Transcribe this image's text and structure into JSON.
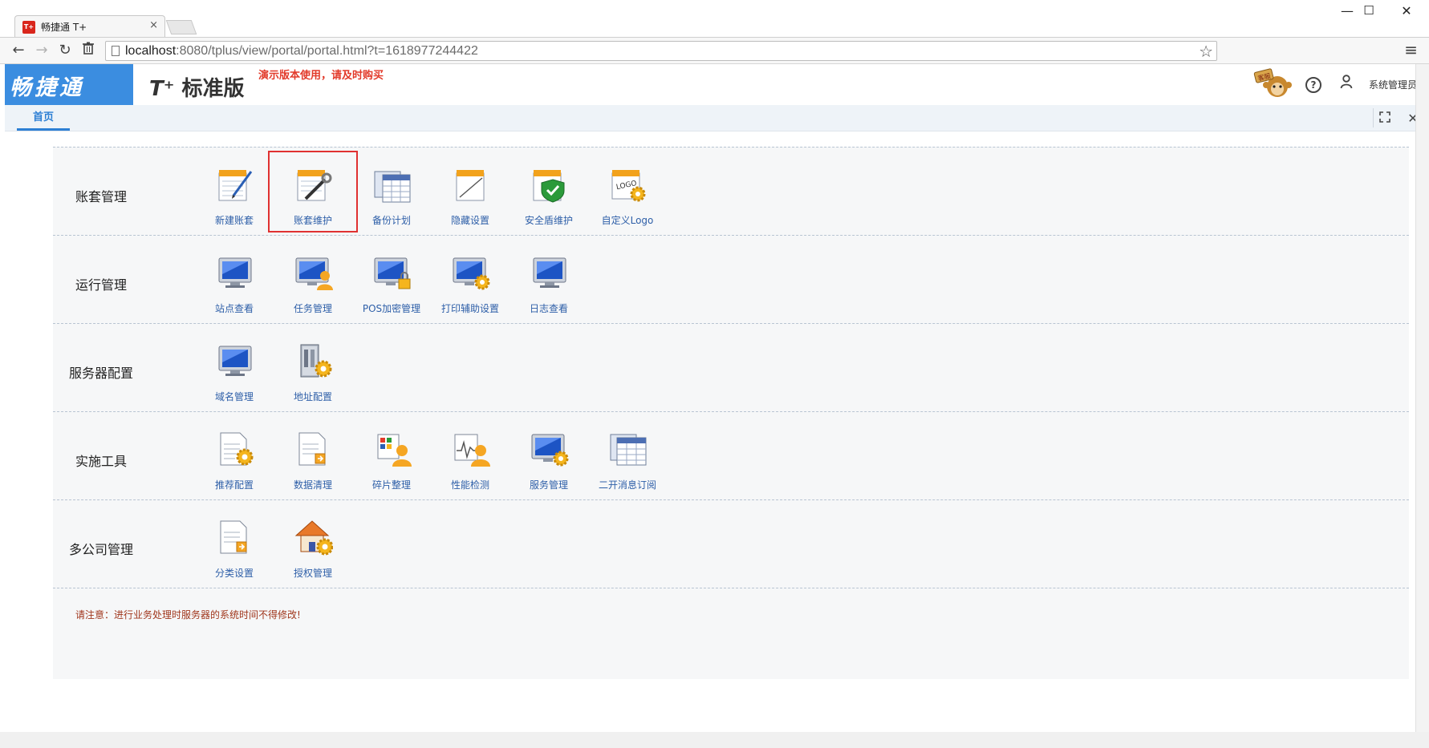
{
  "browser": {
    "tab_title": "畅捷通 T+",
    "tab_favicon": "T+",
    "tab_close": "×",
    "url_host": "localhost",
    "url_rest": ":8080/tplus/view/portal/portal.html?t=1618977244422",
    "window_controls": {
      "minimize": "—",
      "maximize": "☐",
      "close": "✕"
    }
  },
  "header": {
    "brand": "畅捷通",
    "product_prefix": "T⁺",
    "product_name": "标准版",
    "demo_note": "演示版本使用，请及时购买",
    "user": "系统管理员",
    "kefu_label": "客服"
  },
  "page_tabs": [
    {
      "label": "首页",
      "active": true
    }
  ],
  "sections": [
    {
      "label": "账套管理",
      "items": [
        {
          "label": "新建账套",
          "icon": "ledger-pen-icon"
        },
        {
          "label": "账套维护",
          "icon": "ledger-wrench-icon",
          "selected": true
        },
        {
          "label": "备份计划",
          "icon": "backup-calendar-icon"
        },
        {
          "label": "隐藏设置",
          "icon": "hidden-setting-icon"
        },
        {
          "label": "安全盾维护",
          "icon": "shield-check-icon"
        },
        {
          "label": "自定义Logo",
          "icon": "logo-gear-icon"
        }
      ]
    },
    {
      "label": "运行管理",
      "items": [
        {
          "label": "站点查看",
          "icon": "monitor-icon"
        },
        {
          "label": "任务管理",
          "icon": "monitor-user-icon"
        },
        {
          "label": "POS加密管理",
          "icon": "monitor-lock-icon"
        },
        {
          "label": "打印辅助设置",
          "icon": "monitor-gear-icon"
        },
        {
          "label": "日志查看",
          "icon": "monitor-log-icon"
        }
      ]
    },
    {
      "label": "服务器配置",
      "items": [
        {
          "label": "域名管理",
          "icon": "monitor-domain-icon"
        },
        {
          "label": "地址配置",
          "icon": "server-gear-icon"
        }
      ]
    },
    {
      "label": "实施工具",
      "items": [
        {
          "label": "推荐配置",
          "icon": "doc-gear-icon"
        },
        {
          "label": "数据清理",
          "icon": "doc-clean-icon"
        },
        {
          "label": "碎片整理",
          "icon": "fragment-user-icon"
        },
        {
          "label": "性能检测",
          "icon": "performance-user-icon"
        },
        {
          "label": "服务管理",
          "icon": "monitor-service-gear-icon"
        },
        {
          "label": "二开消息订阅",
          "icon": "calendar-subscribe-icon"
        }
      ]
    },
    {
      "label": "多公司管理",
      "items": [
        {
          "label": "分类设置",
          "icon": "doc-category-icon"
        },
        {
          "label": "授权管理",
          "icon": "house-gear-icon"
        }
      ]
    }
  ],
  "notice": "请注意：进行业务处理时服务器的系统时间不得修改!",
  "colors": {
    "brand_blue": "#3b8de0",
    "tab_active": "#2d7fd4",
    "demo_red": "#e23a2a",
    "selected_outline": "#e03131",
    "item_label": "#2e5fa8",
    "notice": "#a0361c"
  }
}
